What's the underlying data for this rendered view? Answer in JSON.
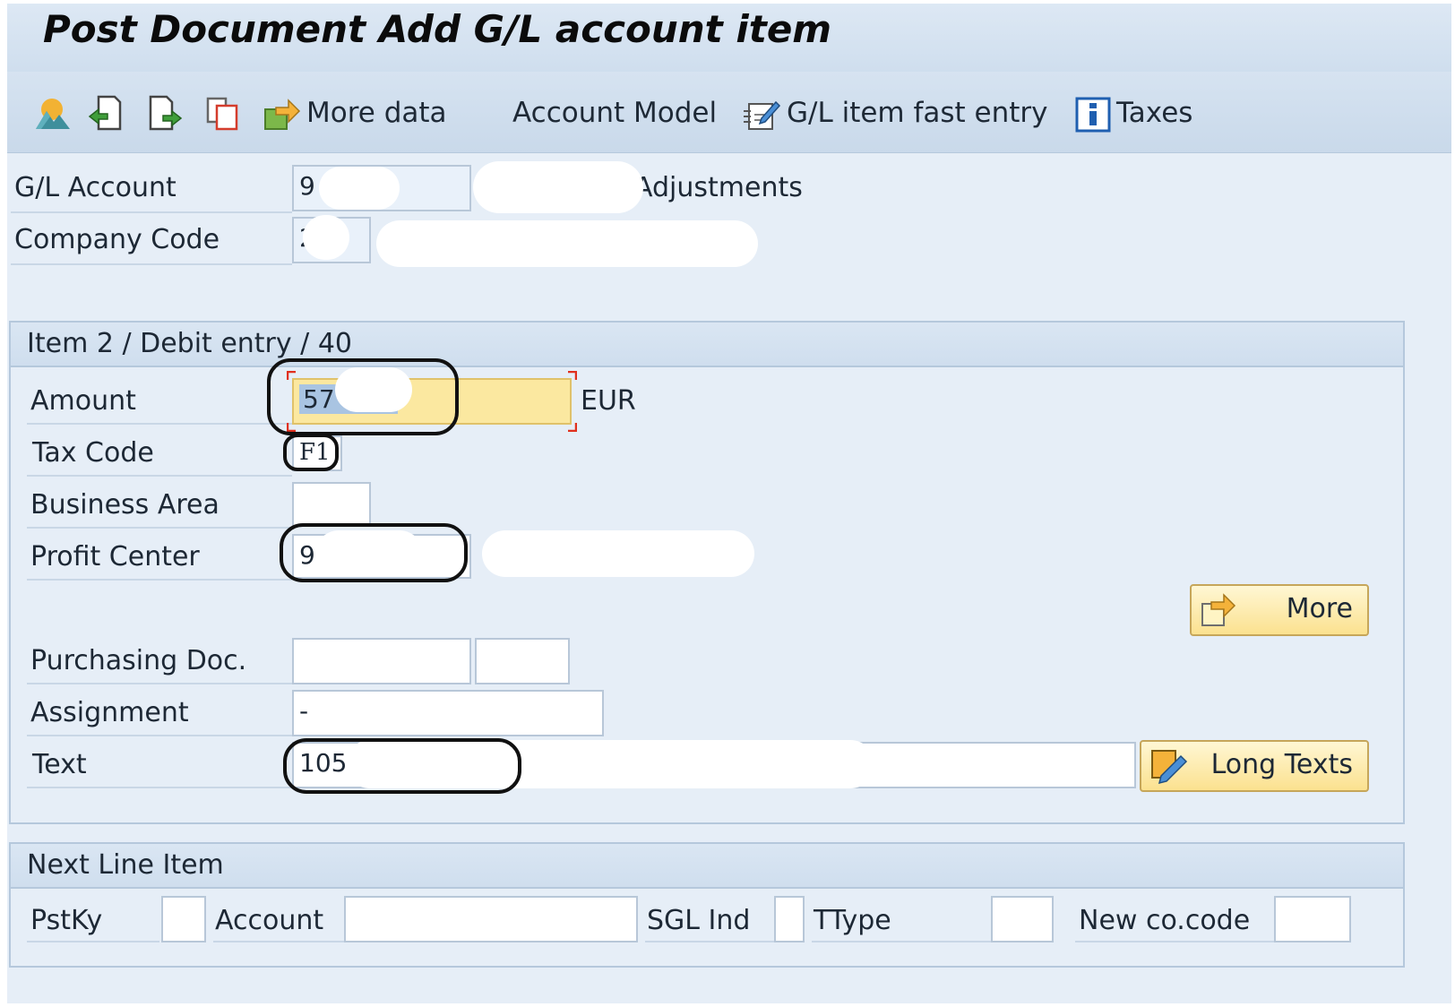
{
  "window": {
    "title": "Post Document Add G/L account item"
  },
  "toolbar": {
    "icons": [
      "mountain-overview-icon",
      "previous-document-icon",
      "next-document-icon",
      "copy-icon"
    ],
    "more_data": "More data",
    "account_model": "Account Model",
    "gl_fast_entry": "G/L item fast entry",
    "taxes": "Taxes"
  },
  "header": {
    "gl_account_label": "G/L Account",
    "gl_account_value": "9        5",
    "gl_account_desc": "Adjustments",
    "company_code_label": "Company Code",
    "company_code_value": "2"
  },
  "item": {
    "group_title": "Item 2 / Debit entry / 40",
    "amount_label": "Amount",
    "amount_value": "57",
    "currency": "EUR",
    "tax_code_label": "Tax Code",
    "tax_code_value": "F1",
    "business_area_label": "Business Area",
    "business_area_value": "",
    "profit_center_label": "Profit Center",
    "profit_center_value": "9",
    "more_button": "More",
    "purchasing_doc_label": "Purchasing Doc.",
    "purchasing_doc_value": "",
    "purchasing_item_value": "",
    "assignment_label": "Assignment",
    "assignment_value": "-",
    "text_label": "Text",
    "text_value": "105",
    "long_texts_button": "Long Texts"
  },
  "next_line": {
    "group_title": "Next Line Item",
    "pstky_label": "PstKy",
    "pstky_value": "",
    "account_label": "Account",
    "account_value": "",
    "sgl_label": "SGL Ind",
    "sgl_value": "",
    "ttype_label": "TType",
    "ttype_value": "",
    "new_cocode_label": "New co.code",
    "new_cocode_value": ""
  },
  "colors": {
    "accent_yellow": "#fbe8a0",
    "panel_blue": "#e6eef7",
    "highlight_outline": "#111111"
  }
}
